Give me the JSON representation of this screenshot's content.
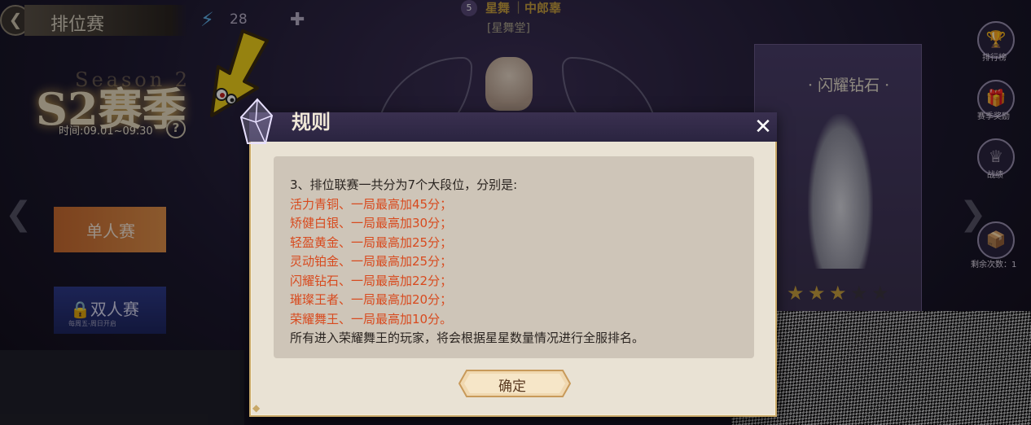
{
  "header": {
    "page_title": "排位赛",
    "energy_count": "28",
    "team": {
      "badge": "5",
      "name": "星舞",
      "separator": "|",
      "role": "中郎辜",
      "hall": "[星舞堂]"
    }
  },
  "season": {
    "label": "S2赛季",
    "deco": "Season 2",
    "dates": "时间:09.01~09.30"
  },
  "modes": {
    "solo_label": "单人赛",
    "duo_label": "双人赛",
    "duo_sub": "每周五-周日开启"
  },
  "rank_card": {
    "title": "· 闪耀钻石 ·",
    "stars_filled": 3,
    "stars_total": 5
  },
  "side_menu": {
    "leaderboard": "排行榜",
    "season_rewards": "赛季奖励",
    "record": "战绩",
    "remaining": "剩余次数：1"
  },
  "modal": {
    "title": "规则",
    "rules": [
      {
        "text": "3、排位联赛一共分为7个大段位，分别是:",
        "color": "black"
      },
      {
        "text": "活力青铜、一局最高加45分；",
        "color": "red"
      },
      {
        "text": "矫健白银、一局最高加30分；",
        "color": "red"
      },
      {
        "text": "轻盈黄金、一局最高加25分；",
        "color": "red"
      },
      {
        "text": "灵动铂金、一局最高加25分；",
        "color": "red"
      },
      {
        "text": "闪耀钻石、一局最高加22分；",
        "color": "red"
      },
      {
        "text": "璀璨王者、一局最高加20分；",
        "color": "red"
      },
      {
        "text": "荣耀舞王、一局最高加10分。",
        "color": "red"
      },
      {
        "text": "所有进入荣耀舞王的玩家，将会根据星星数量情况进行全服排名。",
        "color": "black"
      }
    ],
    "confirm_label": "确定"
  },
  "colors": {
    "accent_red": "#d84a1e",
    "modal_bg": "#e9e2d4",
    "gold": "#c8a868"
  },
  "icons": [
    "back-arrow-icon",
    "lightning-icon",
    "crosshair-icon",
    "help-icon",
    "close-icon",
    "trophy-icon",
    "gift-icon",
    "crown-icon",
    "chest-icon",
    "lock-icon",
    "star-icon",
    "crystal-icon",
    "pointer-arrow-icon"
  ]
}
